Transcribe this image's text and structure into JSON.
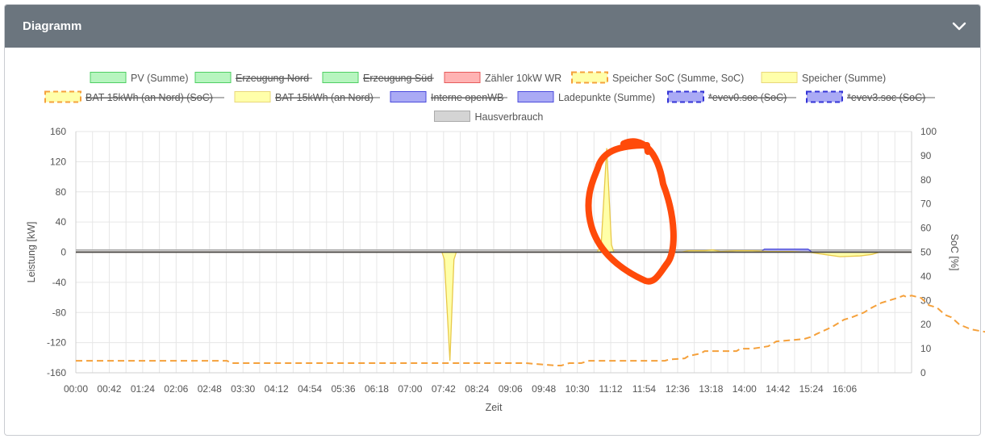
{
  "card": {
    "title": "Diagramm",
    "collapse_icon": "chevron-down-icon"
  },
  "chart_data": {
    "type": "line",
    "xlabel": "Zeit",
    "ylabel": "Leistung [kW]",
    "y2label": "SoC [%]",
    "ylim": [
      -160,
      160
    ],
    "y2lim": [
      0,
      100
    ],
    "xlim_minutes": [
      0,
      1050
    ],
    "yticks": [
      160,
      120,
      80,
      40,
      0,
      -40,
      -80,
      -120,
      -160
    ],
    "y2ticks": [
      100,
      90,
      80,
      70,
      60,
      50,
      40,
      30,
      20,
      10,
      0
    ],
    "xticks": [
      "00:00",
      "00:42",
      "01:24",
      "02:06",
      "02:48",
      "03:30",
      "04:12",
      "04:54",
      "05:36",
      "06:18",
      "07:00",
      "07:42",
      "08:24",
      "09:06",
      "09:48",
      "10:30",
      "11:12",
      "11:54",
      "12:36",
      "13:18",
      "14:00",
      "14:42",
      "15:24",
      "16:06"
    ],
    "grid": true,
    "legend_position": "top",
    "legend": [
      {
        "label": "PV (Summe)",
        "fill": "#b7f5bf",
        "stroke": "#4fcf63",
        "dashed": false,
        "hidden": false
      },
      {
        "label": "Erzeugung Nord",
        "fill": "#b7f5bf",
        "stroke": "#4fcf63",
        "dashed": false,
        "hidden": true
      },
      {
        "label": "Erzeugung Süd",
        "fill": "#b7f5bf",
        "stroke": "#4fcf63",
        "dashed": false,
        "hidden": true
      },
      {
        "label": "Zähler 10kW WR",
        "fill": "#ffb3b3",
        "stroke": "#e65b5b",
        "dashed": false,
        "hidden": false
      },
      {
        "label": "Speicher SoC (Summe, SoC)",
        "fill": "#ffffaa",
        "stroke": "#f5a13c",
        "dashed": true,
        "hidden": false
      },
      {
        "label": "Speicher (Summe)",
        "fill": "#ffffaa",
        "stroke": "#e8d77a",
        "dashed": false,
        "hidden": false
      },
      {
        "label": "BAT 15kWh (an Nord) (SoC)",
        "fill": "#ffffaa",
        "stroke": "#f5a13c",
        "dashed": true,
        "hidden": true
      },
      {
        "label": "BAT 15kWh (an Nord)",
        "fill": "#ffffaa",
        "stroke": "#e8d77a",
        "dashed": false,
        "hidden": true
      },
      {
        "label": "Interne openWB",
        "fill": "#aaaaf5",
        "stroke": "#4a4adc",
        "dashed": false,
        "hidden": true
      },
      {
        "label": "Ladepunkte (Summe)",
        "fill": "#aaaaf5",
        "stroke": "#4a4adc",
        "dashed": false,
        "hidden": false
      },
      {
        "label": "*evev0.soc (SoC)",
        "fill": "#aaaaf5",
        "stroke": "#3434d6",
        "dashed": true,
        "hidden": true
      },
      {
        "label": "*evev3.soc (SoC)",
        "fill": "#aaaaf5",
        "stroke": "#3434d6",
        "dashed": true,
        "hidden": true
      },
      {
        "label": "Hausverbrauch",
        "fill": "#d4d4d4",
        "stroke": "#aaaaaa",
        "dashed": false,
        "hidden": false
      }
    ],
    "series": [
      {
        "name": "Speicher SoC (Summe, SoC)",
        "axis": "y2",
        "color": "#f5a13c",
        "style": "dashed",
        "points": [
          [
            0,
            5
          ],
          [
            190,
            5
          ],
          [
            195,
            4
          ],
          [
            560,
            4
          ],
          [
            565,
            4
          ],
          [
            603,
            3
          ],
          [
            610,
            3
          ],
          [
            620,
            4
          ],
          [
            635,
            4
          ],
          [
            645,
            5
          ],
          [
            740,
            5
          ],
          [
            745,
            5.5
          ],
          [
            765,
            6
          ],
          [
            770,
            7
          ],
          [
            785,
            8
          ],
          [
            790,
            9
          ],
          [
            830,
            9
          ],
          [
            835,
            10
          ],
          [
            850,
            10
          ],
          [
            870,
            11
          ],
          [
            875,
            12
          ],
          [
            880,
            13
          ],
          [
            915,
            14
          ],
          [
            925,
            15
          ],
          [
            930,
            16
          ],
          [
            950,
            19
          ],
          [
            965,
            22
          ],
          [
            975,
            23
          ],
          [
            990,
            25
          ],
          [
            1000,
            27
          ],
          [
            1012,
            29
          ],
          [
            1022,
            30
          ],
          [
            1032,
            31
          ],
          [
            1040,
            32
          ],
          [
            1043,
            31.5
          ],
          [
            1050,
            32
          ],
          [
            1062,
            31
          ],
          [
            1072,
            28
          ],
          [
            1082,
            27
          ],
          [
            1092,
            24
          ],
          [
            1100,
            23
          ],
          [
            1110,
            20
          ],
          [
            1125,
            18
          ],
          [
            1142,
            17
          ],
          [
            1155,
            16
          ],
          [
            1162,
            15
          ],
          [
            1178,
            14
          ],
          [
            1188,
            12
          ],
          [
            1193,
            11
          ],
          [
            1202,
            10
          ],
          [
            1204,
            10
          ],
          [
            1217,
            8
          ],
          [
            1225,
            7
          ],
          [
            1230,
            6
          ]
        ]
      },
      {
        "name": "Speicher (Summe)",
        "axis": "y",
        "color": "#e8c84a",
        "fill": "#ffff99",
        "points": [
          [
            0,
            0
          ],
          [
            460,
            0
          ],
          [
            463,
            -10
          ],
          [
            470,
            -144
          ],
          [
            475,
            -10
          ],
          [
            478,
            0
          ],
          [
            655,
            0
          ],
          [
            660,
            10
          ],
          [
            667,
            138
          ],
          [
            673,
            10
          ],
          [
            676,
            0
          ],
          [
            760,
            0
          ],
          [
            770,
            2
          ],
          [
            790,
            2
          ],
          [
            800,
            3
          ],
          [
            810,
            1
          ],
          [
            830,
            2
          ],
          [
            850,
            2
          ],
          [
            870,
            1
          ],
          [
            900,
            1
          ],
          [
            920,
            0
          ],
          [
            940,
            -3
          ],
          [
            960,
            -6
          ],
          [
            985,
            -5
          ],
          [
            1000,
            -3
          ],
          [
            1010,
            0
          ],
          [
            1050,
            0
          ]
        ]
      },
      {
        "name": "Ladepunkte (Summe)",
        "axis": "y",
        "color": "#4a4adc",
        "fill": "#aaaaf5",
        "points": [
          [
            0,
            0
          ],
          [
            860,
            0
          ],
          [
            865,
            4
          ],
          [
            920,
            4
          ],
          [
            925,
            0
          ],
          [
            1050,
            0
          ]
        ]
      },
      {
        "name": "Hausverbrauch",
        "axis": "y",
        "color": "#aaaaaa",
        "fill": "#d4d4d4",
        "points": [
          [
            0,
            3
          ],
          [
            1050,
            3
          ]
        ]
      },
      {
        "name": "PV (Summe)",
        "axis": "y",
        "color": "#4fcf63",
        "points": [
          [
            0,
            0
          ],
          [
            1050,
            0
          ]
        ]
      },
      {
        "name": "Zähler 10kW WR",
        "axis": "y",
        "color": "#e65b5b",
        "points": [
          [
            0,
            0
          ],
          [
            1050,
            0
          ]
        ]
      }
    ]
  }
}
